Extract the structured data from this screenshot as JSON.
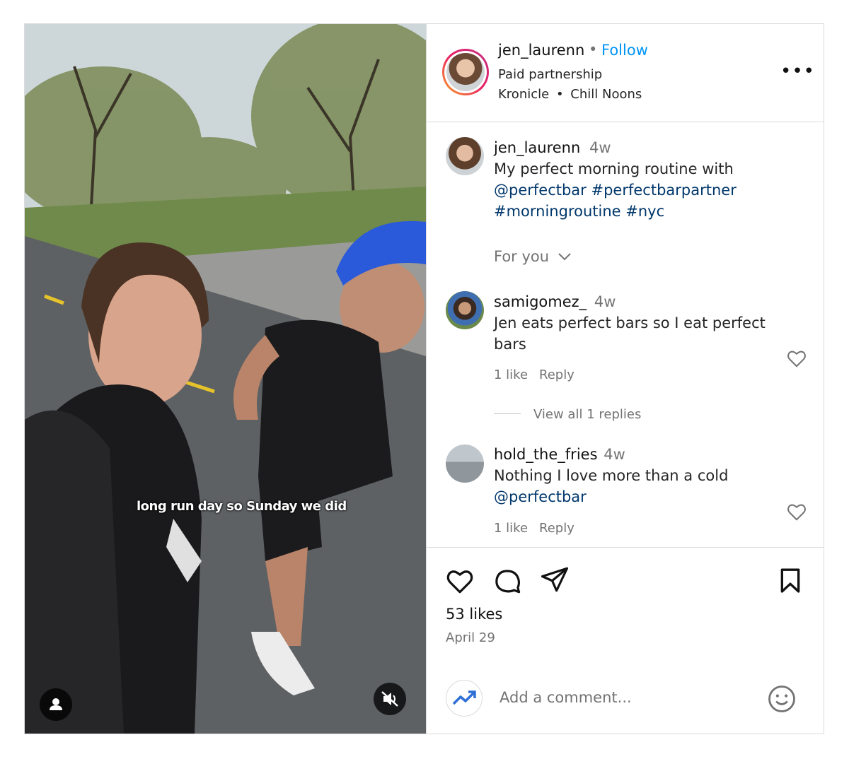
{
  "post": {
    "author": "jen_laurenn",
    "follow_separator": "•",
    "follow_label": "Follow",
    "partnership": "Paid partnership",
    "audio_artist": "Kronicle",
    "audio_separator": "•",
    "audio_title": "Chill Noons",
    "more_label": "•••"
  },
  "media": {
    "caption_overlay": "long run day so Sunday we did"
  },
  "caption": {
    "username": "jen_laurenn",
    "time": "4w",
    "text_plain": "My perfect morning routine with",
    "mention": "@perfectbar",
    "hashtag1": "#perfectbarpartner",
    "hashtag2": "#morningroutine",
    "hashtag3": "#nyc"
  },
  "for_you_label": "For you",
  "comments": [
    {
      "username": "samigomez_",
      "time": "4w",
      "text": "Jen eats perfect bars so I eat perfect bars",
      "likes": "1 like",
      "reply_label": "Reply",
      "view_replies": "View all 1 replies"
    },
    {
      "username": "hold_the_fries",
      "time": "4w",
      "text": "Nothing I love more than a cold",
      "mention": "@perfectbar",
      "likes": "1 like",
      "reply_label": "Reply"
    }
  ],
  "stats": {
    "likes": "53 likes",
    "date": "April 29"
  },
  "add_comment": {
    "placeholder": "Add a comment..."
  },
  "colors": {
    "link_blue": "#0095f6",
    "hashtag_blue": "#00376b",
    "muted_gray": "#737373",
    "border": "#dbdbdb"
  }
}
